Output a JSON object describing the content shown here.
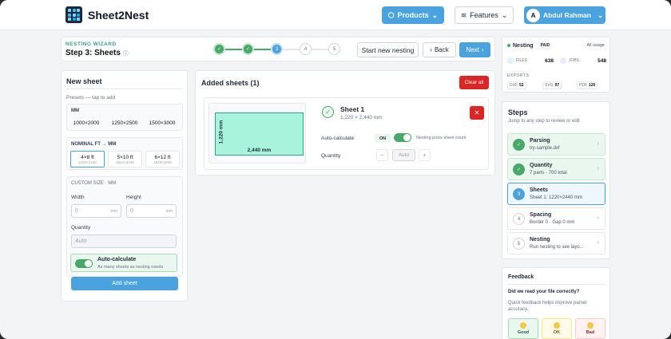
{
  "header": {
    "brand": "Sheet2Nest",
    "products_label": "Products",
    "features_label": "Features",
    "user_initial": "A",
    "user_name": "Abdul Rahman"
  },
  "wizard": {
    "label": "NESTING WIZARD",
    "title": "Step 3: Sheets",
    "steps": [
      "✓",
      "✓",
      "3",
      "4",
      "5"
    ],
    "start_label": "Start new nesting",
    "back_label": "Back",
    "next_label": "Next"
  },
  "usage": {
    "title": "Nesting",
    "plan": "PAID",
    "all_usage": "All usage",
    "files_label": "FILES",
    "files_value": "638",
    "jobs_label": "JOBS",
    "jobs_value": "548",
    "exports_label": "EXPORTS",
    "exports": [
      {
        "label": "DXF",
        "value": "52"
      },
      {
        "label": "SVG",
        "value": "97"
      },
      {
        "label": "PDF",
        "value": "120"
      }
    ]
  },
  "new_sheet": {
    "title": "New sheet",
    "presets_label": "Presets — tap to add",
    "mm_label": "MM",
    "mm_presets": [
      "1000×2000",
      "1250×2500",
      "1500×3000"
    ],
    "nominal_label": "NOMINAL FT → MM",
    "nominal_presets": [
      {
        "name": "4×8 ft",
        "mm": "1220×2440"
      },
      {
        "name": "5×10 ft",
        "mm": "1524×3048"
      },
      {
        "name": "6×12 ft",
        "mm": "1829×3658"
      }
    ],
    "custom_label": "CUSTOM SIZE · MM",
    "width_label": "Width",
    "height_label": "Height",
    "width_placeholder": "0",
    "height_placeholder": "0",
    "unit": "mm",
    "quantity_label": "Quantity",
    "quantity_placeholder": "Auto",
    "auto_title": "Auto-calculate",
    "auto_desc": "As many sheets as nesting needs",
    "add_label": "Add sheet"
  },
  "added": {
    "title": "Added sheets (1)",
    "clear_label": "Clear all",
    "sheet": {
      "name": "Sheet 1",
      "dims": "1,220 × 2,440 mm",
      "height_label": "1,220 mm",
      "width_label": "2,440 mm",
      "auto_label": "Auto-calculate",
      "on_label": "ON",
      "note": "Nesting picks sheet count",
      "quantity_label": "Quantity",
      "quantity_placeholder": "Auto",
      "minus": "−",
      "plus": "+"
    }
  },
  "steps": {
    "title": "Steps",
    "subtitle": "Jump to any step to review or edit",
    "items": [
      {
        "icon": "✓",
        "name": "Parsing",
        "sub": "try-sample.dxf"
      },
      {
        "icon": "✓",
        "name": "Quantity",
        "sub": "7 parts · 700 total"
      },
      {
        "icon": "3",
        "name": "Sheets",
        "sub": "Sheet 1: 1220×2440 mm"
      },
      {
        "icon": "4",
        "name": "Spacing",
        "sub": "Border 0 · Gap 0 mm"
      },
      {
        "icon": "5",
        "name": "Nesting",
        "sub": "Run nesting to see layo..."
      }
    ]
  },
  "feedback": {
    "title": "Feedback",
    "question": "Did we read your file correctly?",
    "desc": "Quick feedback helps improve parser accuracy.",
    "good": "Good",
    "ok": "OK",
    "bad": "Bad"
  }
}
